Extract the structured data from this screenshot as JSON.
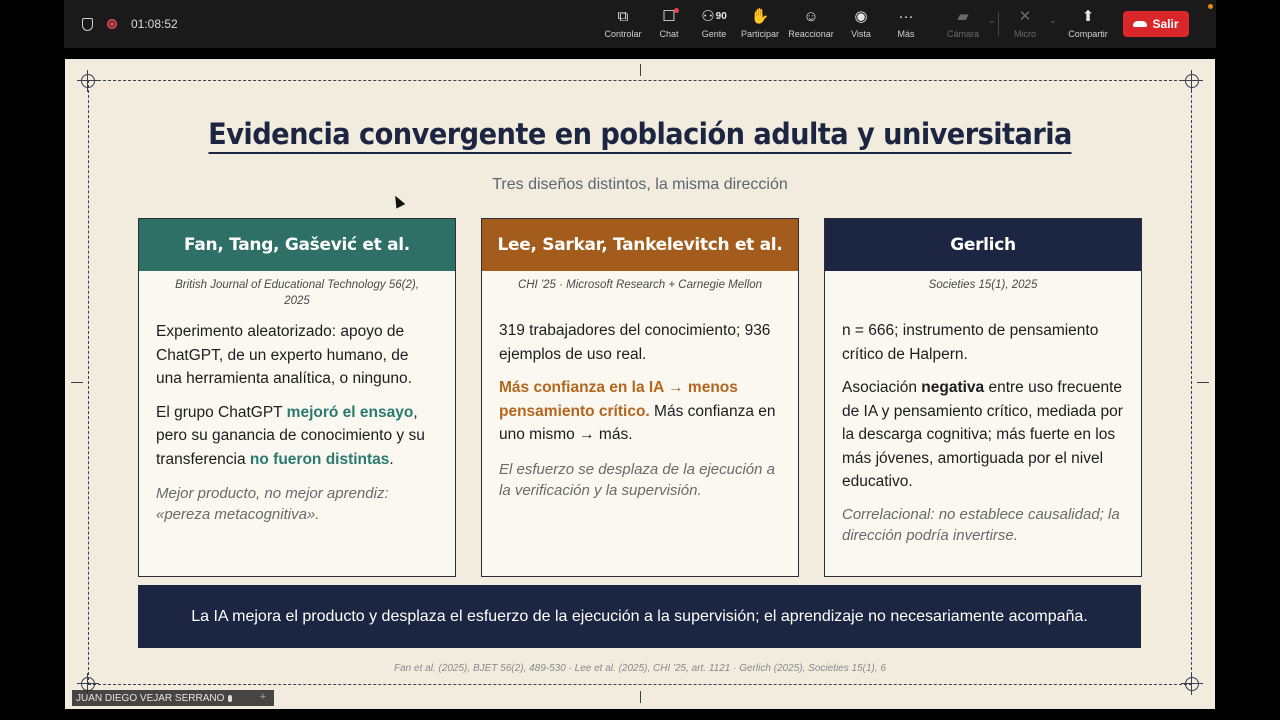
{
  "toolbar": {
    "timer": "01:08:52",
    "participants_count": "90",
    "buttons": {
      "control": "Controlar",
      "chat": "Chat",
      "people": "Gente",
      "participate": "Participar",
      "react": "Reaccionar",
      "view": "Vista",
      "more": "Más",
      "camera": "Cámara",
      "mic": "Micro",
      "share": "Compartir",
      "leave": "Salir"
    }
  },
  "slide": {
    "title": "Evidencia convergente en población adulta y universitaria",
    "subtitle": "Tres diseños distintos, la misma dirección",
    "cards": [
      {
        "head": "Fan, Tang, Gašević et al.",
        "source": "British Journal of Educational Technology 56(2), 2025",
        "p1": "Experimento aleatorizado: apoyo de ChatGPT, de un experto humano, de una herramienta analítica, o ninguno.",
        "p2_a": "El grupo ChatGPT ",
        "p2_b": "mejoró el ensayo",
        "p2_c": ", pero su ganancia de conocimiento y su transferencia ",
        "p2_d": "no fueron distintas",
        "p2_e": ".",
        "note": "Mejor producto, no mejor aprendiz: «pereza metacognitiva»."
      },
      {
        "head": "Lee, Sarkar, Tankelevitch et al.",
        "source": "CHI '25 · Microsoft Research + Carnegie Mellon",
        "p1": "319 trabajadores del conocimiento; 936 ejemplos de uso real.",
        "p2_a": "Más confianza en la IA → menos pensamiento crítico.",
        "p2_b": " Más confianza en uno mismo → más.",
        "note": "El esfuerzo se desplaza de la ejecución a la verificación y la supervisión."
      },
      {
        "head": "Gerlich",
        "source": "Societies 15(1), 2025",
        "p1": "n = 666; instrumento de pensamiento crítico de Halpern.",
        "p2_a": "Asociación ",
        "p2_b": "negativa",
        "p2_c": " entre uso frecuente de IA y pensamiento crítico, mediada por la descarga cognitiva; más fuerte en los más jóvenes, amortiguada por el nivel educativo.",
        "note": "Correlacional: no establece causalidad; la dirección podría invertirse."
      }
    ],
    "banner": "La IA mejora el producto y desplaza el esfuerzo de la ejecución a la supervisión; el aprendizaje no necesariamente acompaña.",
    "references": "Fan et al. (2025), BJET 56(2), 489-530 · Lee et al. (2025), CHI '25, art. 1121 · Gerlich (2025), Societies 15(1), 6"
  },
  "participant": {
    "name": "JUAN DIEGO VEJAR SERRANO"
  },
  "colors": {
    "card1": "#2e6f66",
    "card2": "#a35c1b",
    "card3": "#1c2541",
    "leave": "#d9262b"
  }
}
